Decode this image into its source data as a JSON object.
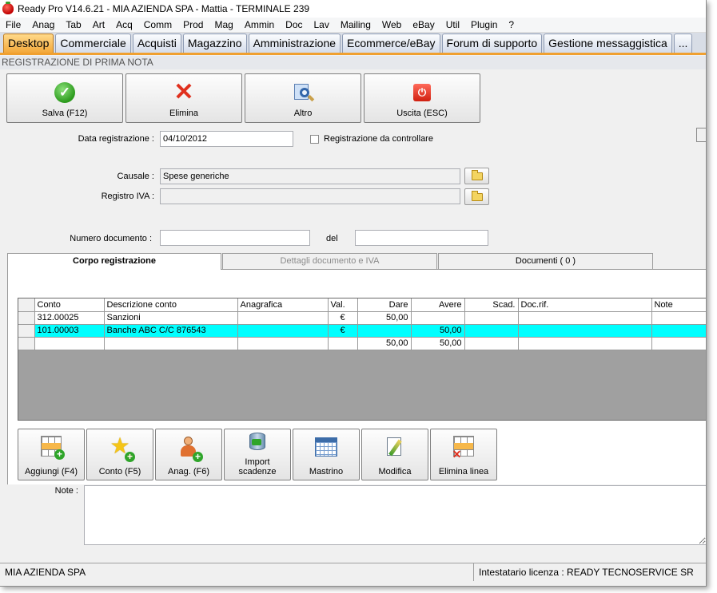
{
  "window": {
    "title": "Ready Pro V14.6.21 - MIA AZIENDA SPA - Mattia - TERMINALE 239"
  },
  "menu": [
    "File",
    "Anag",
    "Tab",
    "Art",
    "Acq",
    "Comm",
    "Prod",
    "Mag",
    "Ammin",
    "Doc",
    "Lav",
    "Mailing",
    "Web",
    "eBay",
    "Util",
    "Plugin",
    "?"
  ],
  "tabs": [
    {
      "label": "Desktop",
      "active": true
    },
    {
      "label": "Commerciale"
    },
    {
      "label": "Acquisti"
    },
    {
      "label": "Magazzino"
    },
    {
      "label": "Amministrazione"
    },
    {
      "label": "Ecommerce/eBay"
    },
    {
      "label": "Forum di supporto"
    },
    {
      "label": "Gestione messaggistica"
    },
    {
      "label": "..."
    }
  ],
  "section_title": "REGISTRAZIONE DI PRIMA NOTA",
  "toolbar": {
    "save": {
      "label": "Salva (F12)",
      "icon": "checkmark-icon"
    },
    "delete": {
      "label": "Elimina",
      "icon": "red-x-icon"
    },
    "other": {
      "label": "Altro",
      "icon": "magnifier-icon"
    },
    "exit": {
      "label": "Uscita (ESC)",
      "icon": "power-icon"
    }
  },
  "form": {
    "data_registrazione_label": "Data registrazione :",
    "data_registrazione_value": "04/10/2012",
    "da_controllare_label": "Registrazione da controllare",
    "causale_label": "Causale :",
    "causale_value": "Spese generiche",
    "registro_iva_label": "Registro IVA :",
    "registro_iva_value": "",
    "numero_documento_label": "Numero documento :",
    "numero_documento_value": "",
    "del_label": "del",
    "del_value": ""
  },
  "inner_tabs": {
    "corpo": "Corpo registrazione",
    "dettagli": "Dettagli documento e IVA",
    "documenti": "Documenti ( 0 )"
  },
  "grid": {
    "columns": [
      "Conto",
      "Descrizione conto",
      "Anagrafica",
      "Val.",
      "Dare",
      "Avere",
      "Scad.",
      "Doc.rif.",
      "Note"
    ],
    "rows": [
      {
        "conto": "312.00025",
        "descrizione": "Sanzioni",
        "anagrafica": "",
        "val": "€",
        "dare": "50,00",
        "avere": "",
        "scad": "",
        "docrif": "",
        "note": ""
      },
      {
        "conto": "101.00003",
        "descrizione": "Banche ABC C/C 876543",
        "anagrafica": "",
        "val": "€",
        "dare": "",
        "avere": "50,00",
        "scad": "",
        "docrif": "",
        "note": ""
      }
    ],
    "totals": {
      "dare": "50,00",
      "avere": "50,00"
    }
  },
  "bottom_toolbar": {
    "add": "Aggiungi (F4)",
    "conto": "Conto (F5)",
    "anag": "Anag. (F6)",
    "import_1": "Import",
    "import_2": "scadenze",
    "mastrino": "Mastrino",
    "modifica": "Modifica",
    "elimina_linea": "Elimina linea"
  },
  "note_label": "Note :",
  "status": {
    "left": "MIA AZIENDA SPA",
    "right": "Intestatario licenza : READY TECNOSERVICE SR"
  },
  "colors": {
    "selected_row": "#00ffff",
    "active_tab": "#f3a83a"
  }
}
